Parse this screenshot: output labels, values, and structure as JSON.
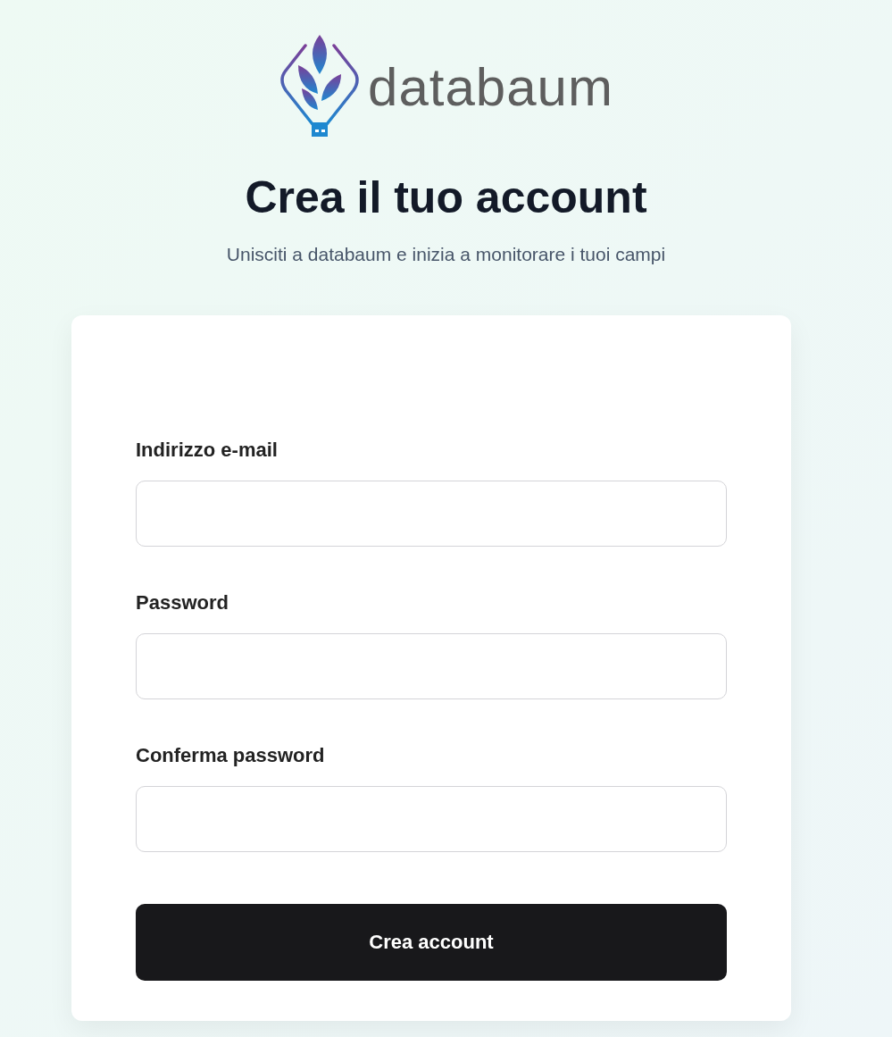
{
  "logo": {
    "text": "databaum"
  },
  "title": "Crea il tuo account",
  "subtitle": "Unisciti a databaum e inizia a monitorare i tuoi campi",
  "fields": [
    {
      "label": "Indirizzo e-mail"
    },
    {
      "label": "Password"
    },
    {
      "label": "Conferma password"
    }
  ],
  "submit": {
    "label": "Crea account"
  }
}
